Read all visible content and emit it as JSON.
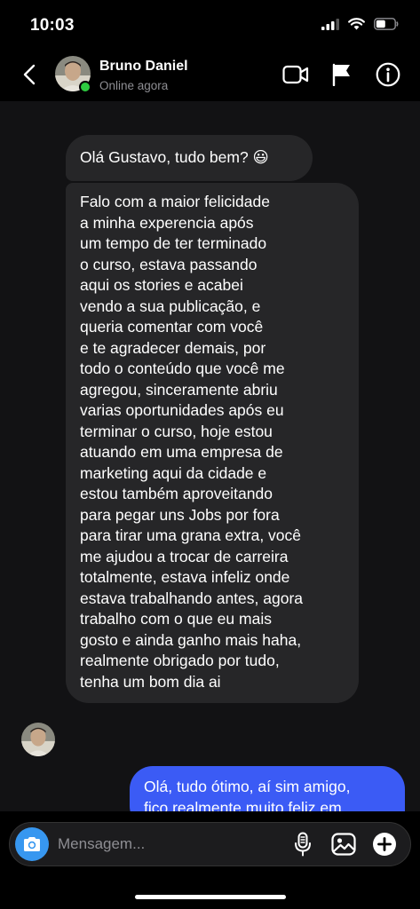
{
  "status_bar": {
    "time": "10:03"
  },
  "header": {
    "contact_name": "Bruno Daniel",
    "contact_status": "Online agora",
    "online_color": "#2ecc40",
    "icons": [
      "chevron-left-icon",
      "video-camera-icon",
      "flag-icon",
      "info-icon"
    ]
  },
  "messages": [
    {
      "direction": "incoming",
      "lines": [
        "Olá Gustavo, tudo bem? 😃"
      ]
    },
    {
      "direction": "incoming",
      "lines": [
        "Falo com a maior felicidade",
        "a minha experencia após",
        "um tempo de ter terminado",
        "o curso, estava passando",
        "aqui os stories e acabei",
        "vendo a sua publicação, e",
        "queria comentar com você",
        "e te agradecer demais, por",
        "todo o conteúdo que você me",
        "agregou, sinceramente abriu",
        "varias oportunidades após eu",
        "terminar o curso, hoje estou",
        "atuando em uma empresa de",
        "marketing aqui da cidade e",
        "estou também aproveitando",
        "para pegar uns Jobs por fora",
        "para tirar uma grana extra, você",
        "me ajudou a trocar de carreira",
        "totalmente, estava infeliz onde",
        "estava trabalhando antes, agora",
        "trabalho com o que eu mais",
        "gosto e ainda ganho mais haha,",
        "realmente obrigado por tudo,",
        "tenha um bom dia ai"
      ]
    },
    {
      "direction": "outgoing",
      "lines": [
        "Olá, tudo ótimo, aí sim amigo,",
        "fico realmente muito feliz em"
      ]
    }
  ],
  "composer": {
    "placeholder": "Mensagem...",
    "icons": [
      "camera-icon",
      "microphone-icon",
      "gallery-icon",
      "plus-icon"
    ],
    "camera_color": "#3797f0"
  },
  "colors": {
    "incoming_bubble": "#262628",
    "outgoing_bubble": "#3b5bf5",
    "chat_background": "#121214"
  }
}
